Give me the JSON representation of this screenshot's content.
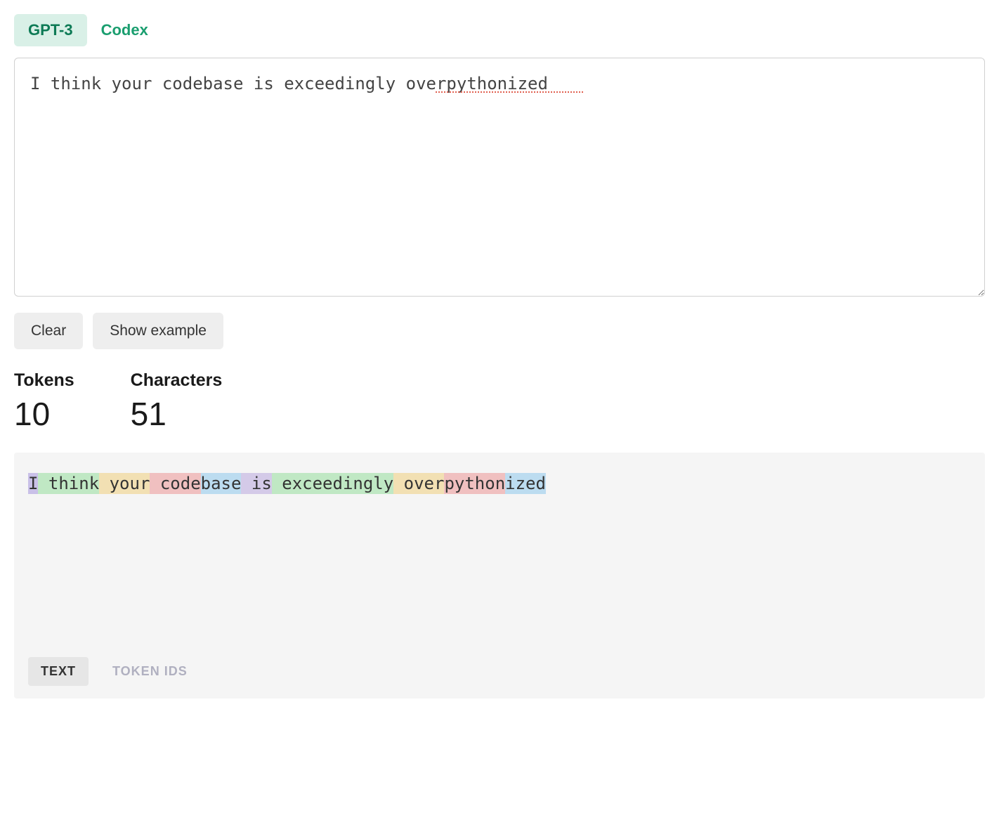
{
  "tabs": {
    "gpt3": "GPT-3",
    "codex": "Codex",
    "active": "gpt3"
  },
  "input": {
    "value": "I think your codebase is exceedingly overpythonized"
  },
  "buttons": {
    "clear": "Clear",
    "show_example": "Show example"
  },
  "stats": {
    "tokens_label": "Tokens",
    "tokens_value": "10",
    "chars_label": "Characters",
    "chars_value": "51"
  },
  "tokens": [
    {
      "text": "I",
      "color": 0
    },
    {
      "text": " think",
      "color": 1
    },
    {
      "text": " your",
      "color": 2
    },
    {
      "text": " code",
      "color": 3
    },
    {
      "text": "base",
      "color": 4
    },
    {
      "text": " is",
      "color": 5
    },
    {
      "text": " exceedingly",
      "color": 1
    },
    {
      "text": " over",
      "color": 2
    },
    {
      "text": "python",
      "color": 3
    },
    {
      "text": "ized",
      "color": 4
    }
  ],
  "view_tabs": {
    "text": "TEXT",
    "token_ids": "TOKEN IDS",
    "active": "text"
  }
}
